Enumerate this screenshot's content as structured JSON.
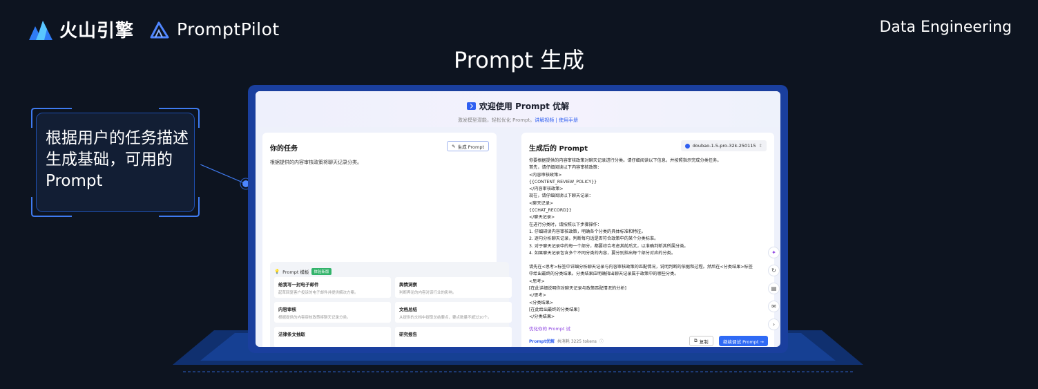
{
  "header": {
    "volc_brand": "火山引擎",
    "product_brand": "PromptPilot",
    "tag": "Data Engineering",
    "title": "Prompt 生成"
  },
  "callout": {
    "text": "根据用户的任务描述生成基础，可用的 Prompt"
  },
  "app": {
    "title": "欢迎使用 Prompt 优解",
    "subtitle": "激发模型潜能，轻松优化 Prompt。",
    "link_tutorial": "讲解视频",
    "sep": " | ",
    "link_manual": "使用手册",
    "left": {
      "heading": "你的任务",
      "generate_button": "生成 Prompt",
      "task_text": "根据提供的内容审核政策将聊天记录分类。",
      "templates": {
        "heading": "Prompt 模板",
        "badge": "体验新版",
        "cards": [
          {
            "title": "给我写一封电子邮件",
            "desc": "起草回复客户投诉的电子邮件并提供解决方案。"
          },
          {
            "title": "舆情洞察",
            "desc": "判断舆论的内容对该行业的影响。"
          },
          {
            "title": "内容审核",
            "desc": "根据提供的内容审核政策将聊天记录分类。"
          },
          {
            "title": "文档总结",
            "desc": "从提供的文档中提取总结要点，要点数量不超过10个。"
          },
          {
            "title": "法律条文抽取",
            "desc": ""
          },
          {
            "title": "研究报告",
            "desc": ""
          }
        ]
      }
    },
    "right": {
      "heading": "生成后的 Prompt",
      "model": "doubao-1.5-pro-32k-250115",
      "lines": [
        "你要根据提供的内容审核政策对聊天记录进行分类。请仔细阅读以下信息，并按照指示完成分类任务。",
        "首先，请仔细阅读以下内容审核政策：",
        "<内容审核政策>",
        "{{CONTENT_REVIEW_POLICY}}",
        "</内容审核政策>",
        "现在，请仔细阅读以下聊天记录：",
        "<聊天记录>",
        "{{CHAT_RECORD}}",
        "</聊天记录>",
        "在进行分类时，请按照以下步骤操作：",
        "1. 仔细研读内容审核政策，明确各个分类的具体标准和特征。",
        "2. 逐句分析聊天记录，判断每句话是否符合政策中的某个分类标准。",
        "3. 对于聊天记录中的每一个部分，都要综合考虑其前后文，以准确判断其所属分类。",
        "4. 如果聊天记录包含多个不同分类的内容，要分别指出每个部分对应的分类。",
        "",
        "请先在<思考>标签中详细分析聊天记录与内容审核政策的匹配情况，说明判断的依据和过程。然后在<分类结果>标签中给出最终的分类结果。分类结果应明确指出聊天记录属于政策中的哪些分类。",
        "<思考>",
        "[在此详细说明你对聊天记录与政策匹配情况的分析]",
        "</思考>",
        "<分类结果>",
        "[在此给出最终的分类结果]",
        "</分类结果>"
      ],
      "optimize_link": "优化你的 Prompt 试",
      "footer_brand": "Prompt优解",
      "token_usage": "共消耗 3225 tokens",
      "copy_button": "复制",
      "continue_button": "继续调试 Prompt →"
    },
    "side_icons": [
      "sparkle-icon",
      "history-icon",
      "book-icon",
      "message-icon",
      "chevron-right-icon"
    ]
  }
}
